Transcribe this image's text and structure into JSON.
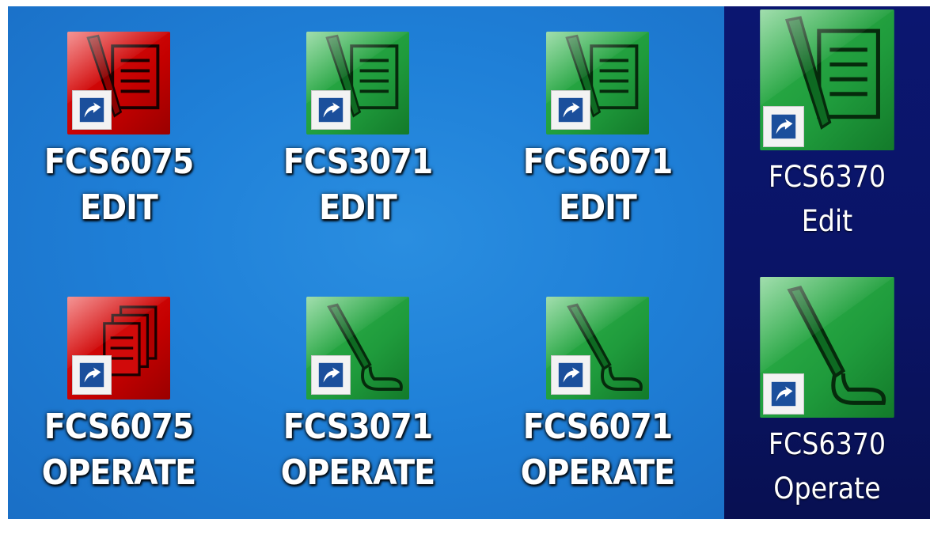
{
  "icons": [
    {
      "line1": "FCS6075",
      "line2": "EDIT"
    },
    {
      "line1": "FCS3071",
      "line2": "EDIT"
    },
    {
      "line1": "FCS6071",
      "line2": "EDIT"
    },
    {
      "line1": "FCS6370",
      "line2": "Edit"
    },
    {
      "line1": "FCS6075",
      "line2": "OPERATE"
    },
    {
      "line1": "FCS3071",
      "line2": "OPERATE"
    },
    {
      "line1": "FCS6071",
      "line2": "OPERATE"
    },
    {
      "line1": "FCS6370",
      "line2": "Operate"
    }
  ],
  "colors": {
    "desktop": "#1f80d8",
    "selection": "#0a1466",
    "red_tile": "#c40000",
    "green_tile": "#1f9b3c"
  },
  "icon_names": {
    "edit": "document-pen-icon",
    "edit_red": "red-document-pen-icon",
    "operate": "microphone-icon",
    "operate_red": "red-documents-icon",
    "shortcut": "shortcut-arrow-icon"
  },
  "selected_column": 4
}
